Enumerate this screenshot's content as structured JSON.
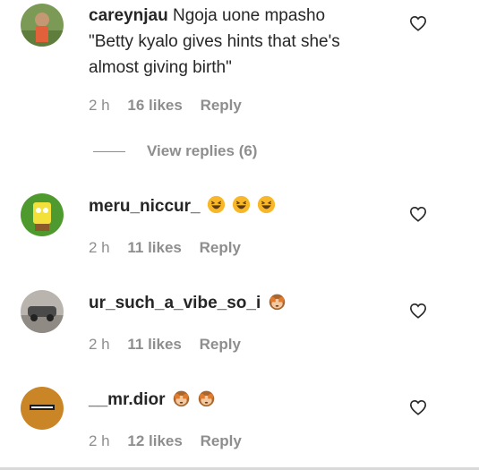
{
  "comments": [
    {
      "username": "careynjau",
      "text_line1": "Ngoja uone mpasho",
      "text_line2": "\"Betty kyalo gives hints that she's",
      "text_line3": "almost giving birth\"",
      "time": "2 h",
      "likes": "16 likes",
      "reply": "Reply",
      "view_replies": "View replies (6)"
    },
    {
      "username": "meru_niccur_",
      "time": "2 h",
      "likes": "11 likes",
      "reply": "Reply"
    },
    {
      "username": "ur_such_a_vibe_so_i",
      "time": "2 h",
      "likes": "11 likes",
      "reply": "Reply"
    },
    {
      "username": "__mr.dior",
      "time": "2 h",
      "likes": "12 likes",
      "reply": "Reply"
    }
  ],
  "icons": {
    "like": "heart-outline-icon",
    "laugh": "laughing-emoji-icon",
    "monkey": "see-no-evil-monkey-icon"
  },
  "colors": {
    "text": "#262626",
    "secondary": "#8e8e8e"
  }
}
